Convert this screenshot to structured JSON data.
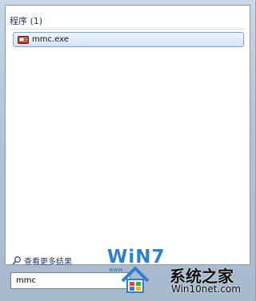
{
  "start_menu": {
    "group_header": "程序 (1)",
    "results": [
      {
        "label": "mmc.exe",
        "icon": "mmc-icon"
      }
    ],
    "see_more_label": "查看更多结果",
    "search": {
      "value": "mmc"
    }
  },
  "watermark": {
    "logo_text": "WiN7",
    "site_name_cn": "系统之家",
    "site_url": "Win10net.com",
    "small_text": "www."
  },
  "colors": {
    "header_text": "#1e395b",
    "selection_border": "#7da2ce",
    "watermark_blue": "#2f7fcf"
  }
}
